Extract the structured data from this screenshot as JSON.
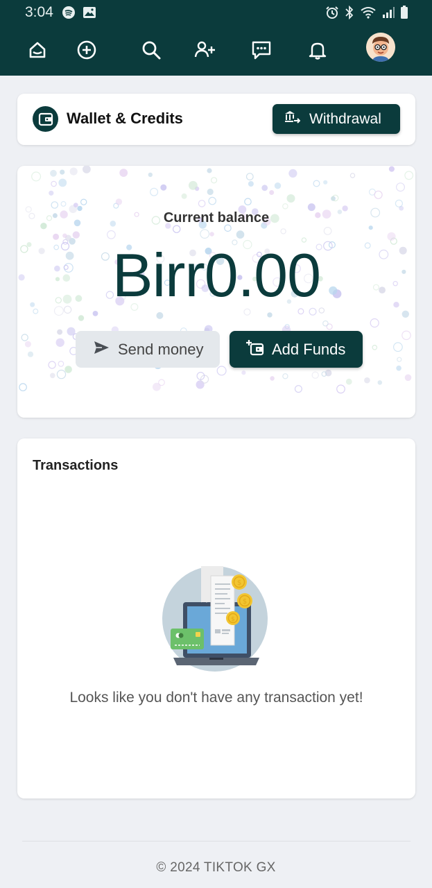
{
  "status_bar": {
    "time": "3:04",
    "left_icons": [
      "spotify-icon",
      "gallery-icon"
    ],
    "right_icons": [
      "alarm-icon",
      "bluetooth-icon",
      "wifi-icon",
      "signal-icon",
      "battery-icon"
    ]
  },
  "nav": {
    "items": [
      "home-icon",
      "create-icon",
      "search-icon",
      "add-user-icon",
      "messages-icon",
      "notifications-icon",
      "avatar"
    ]
  },
  "wallet": {
    "title": "Wallet & Credits",
    "withdraw_label": "Withdrawal"
  },
  "balance": {
    "label": "Current balance",
    "amount": "Birr0.00",
    "send_label": "Send money",
    "add_label": "Add Funds"
  },
  "transactions": {
    "title": "Transactions",
    "empty_message": "Looks like you don't have any transaction yet!"
  },
  "footer": {
    "text": "© 2024 TIKTOK GX"
  },
  "colors": {
    "brand": "#0b3b3c",
    "background": "#eef0f4",
    "card": "#ffffff",
    "secondary_button": "#e4e8ec"
  }
}
